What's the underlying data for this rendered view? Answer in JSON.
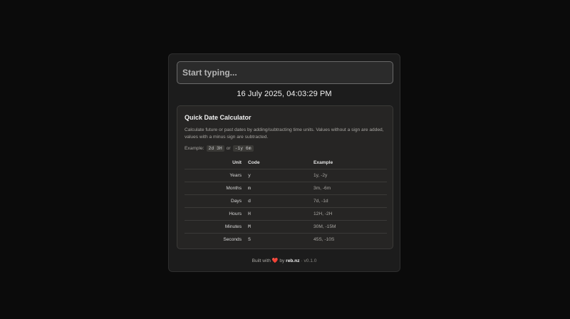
{
  "search": {
    "placeholder": "Start typing..."
  },
  "datetime": "16 July 2025, 04:03:29 PM",
  "calculator": {
    "title": "Quick Date Calculator",
    "description": "Calculate future or past dates by adding/subtracting time units. Values without a sign are added, values with a minus sign are subtracted.",
    "example_label": "Example:",
    "example_a": "2d 3H",
    "example_or": "or",
    "example_b": "-1y 6m",
    "headers": {
      "unit": "Unit",
      "code": "Code",
      "example": "Example"
    },
    "rows": [
      {
        "unit": "Years",
        "code": "y",
        "example": "1y, -2y"
      },
      {
        "unit": "Months",
        "code": "m",
        "example": "3m, -6m"
      },
      {
        "unit": "Days",
        "code": "d",
        "example": "7d, -1d"
      },
      {
        "unit": "Hours",
        "code": "H",
        "example": "12H, -2H"
      },
      {
        "unit": "Minutes",
        "code": "M",
        "example": "30M, -15M"
      },
      {
        "unit": "Seconds",
        "code": "S",
        "example": "45S, -10S"
      }
    ]
  },
  "footer": {
    "built_with": "Built with",
    "heart_icon": "heart-icon",
    "by": "by",
    "brand": "reb.nz",
    "version": "· v0.1.0"
  },
  "colors": {
    "background": "#0b0b0b",
    "panel": "#1c1c1c",
    "card": "#262524",
    "heart": "#e0433d"
  }
}
